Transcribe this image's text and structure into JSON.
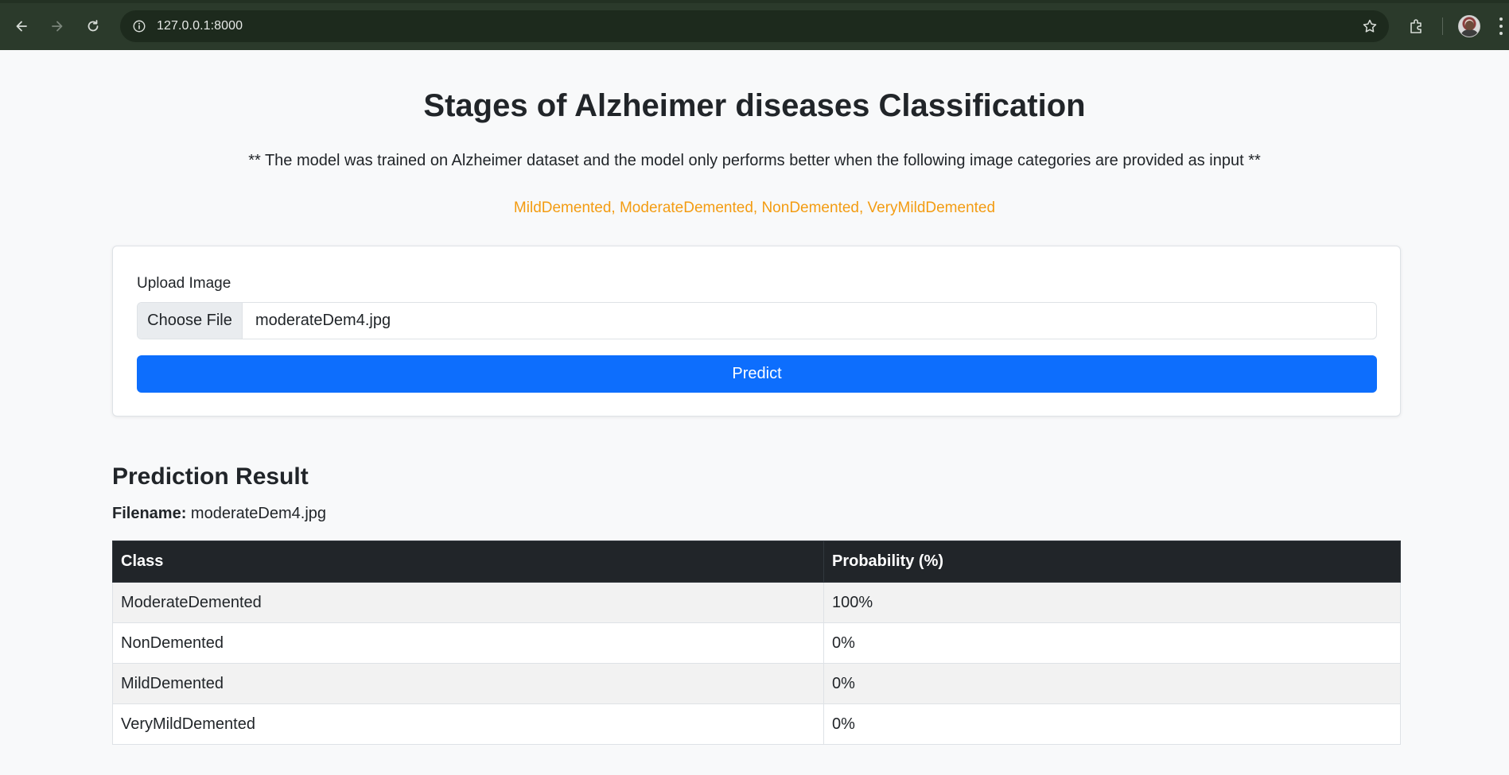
{
  "browser": {
    "url": "127.0.0.1:8000"
  },
  "page": {
    "title": "Stages of Alzheimer diseases Classification",
    "subtitle": "** The model was trained on Alzheimer dataset and the model only performs better when the following image categories are provided as input **",
    "categories": "MildDemented, ModerateDemented, NonDemented, VeryMildDemented",
    "categories_color": "#f39c12"
  },
  "upload_form": {
    "label": "Upload Image",
    "choose_file_label": "Choose File",
    "selected_file": "moderateDem4.jpg",
    "predict_label": "Predict",
    "predict_color": "#0d6efd"
  },
  "result": {
    "heading": "Prediction Result",
    "filename_label": "Filename:",
    "filename_value": "moderateDem4.jpg",
    "columns": [
      "Class",
      "Probability (%)"
    ],
    "rows": [
      {
        "class": "ModerateDemented",
        "probability": "100%"
      },
      {
        "class": "NonDemented",
        "probability": "0%"
      },
      {
        "class": "MildDemented",
        "probability": "0%"
      },
      {
        "class": "VeryMildDemented",
        "probability": "0%"
      }
    ]
  }
}
